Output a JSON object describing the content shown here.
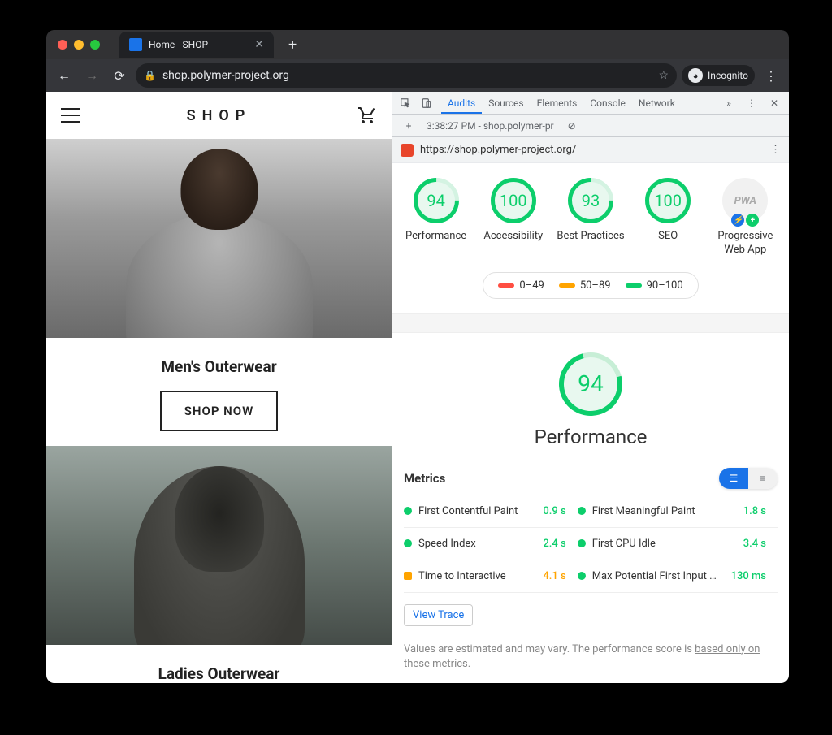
{
  "browser": {
    "tab_title": "Home - SHOP",
    "url_display": "shop.polymer-project.org",
    "incognito_label": "Incognito"
  },
  "shop": {
    "logo": "SHOP",
    "section1_title": "Men's Outerwear",
    "shop_now": "SHOP NOW",
    "section2_title": "Ladies Outerwear"
  },
  "devtools": {
    "tabs": [
      "Audits",
      "Sources",
      "Elements",
      "Console",
      "Network"
    ],
    "timestamp": "3:38:27 PM - shop.polymer-pr",
    "audit_url": "https://shop.polymer-project.org/",
    "gauges": [
      {
        "value": "94",
        "label": "Performance"
      },
      {
        "value": "100",
        "label": "Accessibility"
      },
      {
        "value": "93",
        "label": "Best Practices"
      },
      {
        "value": "100",
        "label": "SEO"
      }
    ],
    "pwa_label": "Progressive Web App",
    "legend": [
      {
        "range": "0–49"
      },
      {
        "range": "50–89"
      },
      {
        "range": "90–100"
      }
    ],
    "big_gauge": {
      "value": "94",
      "label": "Performance"
    },
    "metrics_title": "Metrics",
    "metrics": [
      {
        "name": "First Contentful Paint",
        "value": "0.9 s",
        "status": "green"
      },
      {
        "name": "First Meaningful Paint",
        "value": "1.8 s",
        "status": "green"
      },
      {
        "name": "Speed Index",
        "value": "2.4 s",
        "status": "green"
      },
      {
        "name": "First CPU Idle",
        "value": "3.4 s",
        "status": "green"
      },
      {
        "name": "Time to Interactive",
        "value": "4.1 s",
        "status": "orange"
      },
      {
        "name": "Max Potential First Input Delay",
        "value": "130 ms",
        "status": "green"
      }
    ],
    "view_trace": "View Trace",
    "footnote_prefix": "Values are estimated and may vary. The performance score is ",
    "footnote_link": "based only on these metrics",
    "footnote_suffix": "."
  }
}
